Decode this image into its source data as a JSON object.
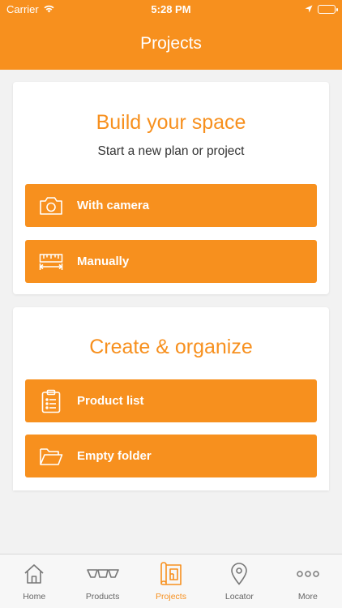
{
  "status_bar": {
    "carrier": "Carrier",
    "time": "5:28 PM"
  },
  "nav": {
    "title": "Projects"
  },
  "build_card": {
    "title": "Build your space",
    "subtitle": "Start a new plan or project",
    "buttons": [
      {
        "label": "With camera",
        "icon": "camera-icon"
      },
      {
        "label": "Manually",
        "icon": "ruler-icon"
      }
    ]
  },
  "organize_card": {
    "title": "Create & organize",
    "buttons": [
      {
        "label": "Product list",
        "icon": "clipboard-list-icon"
      },
      {
        "label": "Empty folder",
        "icon": "folder-icon"
      }
    ]
  },
  "tabbar": {
    "items": [
      {
        "label": "Home",
        "icon": "home-icon"
      },
      {
        "label": "Products",
        "icon": "products-icon"
      },
      {
        "label": "Projects",
        "icon": "projects-icon",
        "active": true
      },
      {
        "label": "Locator",
        "icon": "location-pin-icon"
      },
      {
        "label": "More",
        "icon": "more-dots-icon"
      }
    ]
  },
  "colors": {
    "accent": "#f7901e",
    "background": "#f2f2f2",
    "tab_inactive": "#666666"
  }
}
